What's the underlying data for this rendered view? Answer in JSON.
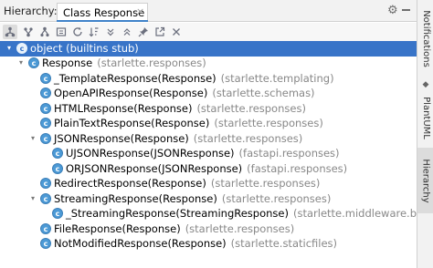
{
  "header": {
    "title": "Hierarchy:",
    "tab_label": "Class Response",
    "tab_close": "×",
    "gear": "⚙",
    "minimize": "minimize"
  },
  "toolbar": {
    "icons": [
      "type-hierarchy-icon",
      "supertypes-icon",
      "subtypes-icon",
      "scope-icon",
      "sort-icon",
      "refresh-icon",
      "expand-icon",
      "collapse-icon",
      "pin-icon",
      "autoscroll-icon",
      "export-icon"
    ]
  },
  "tree": {
    "rows": [
      {
        "name": "object (builtins stub)",
        "pkg": "",
        "selected": true
      },
      {
        "name": "Response",
        "pkg": "(starlette.responses)"
      },
      {
        "name": "_TemplateResponse(Response)",
        "pkg": "(starlette.templating)"
      },
      {
        "name": "OpenAPIResponse(Response)",
        "pkg": "(starlette.schemas)"
      },
      {
        "name": "HTMLResponse(Response)",
        "pkg": "(starlette.responses)"
      },
      {
        "name": "PlainTextResponse(Response)",
        "pkg": "(starlette.responses)"
      },
      {
        "name": "JSONResponse(Response)",
        "pkg": "(starlette.responses)"
      },
      {
        "name": "UJSONResponse(JSONResponse)",
        "pkg": "(fastapi.responses)"
      },
      {
        "name": "ORJSONResponse(JSONResponse)",
        "pkg": "(fastapi.responses)"
      },
      {
        "name": "RedirectResponse(Response)",
        "pkg": "(starlette.responses)"
      },
      {
        "name": "StreamingResponse(Response)",
        "pkg": "(starlette.responses)"
      },
      {
        "name": "_StreamingResponse(StreamingResponse)",
        "pkg": "(starlette.middleware.base)"
      },
      {
        "name": "FileResponse(Response)",
        "pkg": "(starlette.responses)"
      },
      {
        "name": "NotModifiedResponse(Response)",
        "pkg": "(starlette.staticfiles)"
      }
    ]
  },
  "side_tabs": {
    "notifications": "Notifications",
    "plantuml": "PlantUML",
    "hierarchy": "Hierarchy"
  },
  "colors": {
    "selection": "#3874c8",
    "class_icon": "#4c9ad6",
    "package_text": "#888888"
  }
}
